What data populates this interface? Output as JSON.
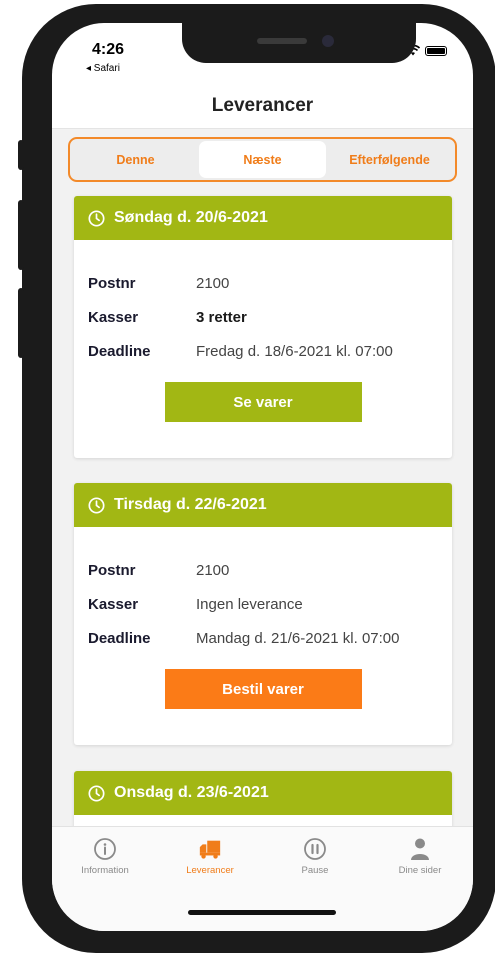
{
  "status": {
    "time": "4:26",
    "back_label": "◂ Safari"
  },
  "header": {
    "title": "Leverancer"
  },
  "segments": [
    {
      "label": "Denne"
    },
    {
      "label": "Næste"
    },
    {
      "label": "Efterfølgende"
    }
  ],
  "cards": [
    {
      "date": "Søndag d. 20/6-2021",
      "rows": [
        {
          "key": "Postnr",
          "value": "2100"
        },
        {
          "key": "Kasser",
          "value": "3 retter"
        },
        {
          "key": "Deadline",
          "value": "Fredag d. 18/6-2021 kl. 07:00"
        }
      ],
      "button_label": "Se varer"
    },
    {
      "date": "Tirsdag d. 22/6-2021",
      "rows": [
        {
          "key": "Postnr",
          "value": "2100"
        },
        {
          "key": "Kasser",
          "value": "Ingen leverance"
        },
        {
          "key": "Deadline",
          "value": "Mandag d. 21/6-2021 kl. 07:00"
        }
      ],
      "button_label": "Bestil varer"
    },
    {
      "date": "Onsdag d. 23/6-2021"
    }
  ],
  "tabbar": [
    {
      "label": "Information",
      "icon": "info-icon"
    },
    {
      "label": "Leverancer",
      "icon": "truck-icon"
    },
    {
      "label": "Pause",
      "icon": "pause-icon"
    },
    {
      "label": "Dine sider",
      "icon": "user-icon"
    }
  ],
  "colors": {
    "accent_green": "#a2b714",
    "accent_orange": "#f07d1a",
    "button_orange": "#fb7b17"
  }
}
